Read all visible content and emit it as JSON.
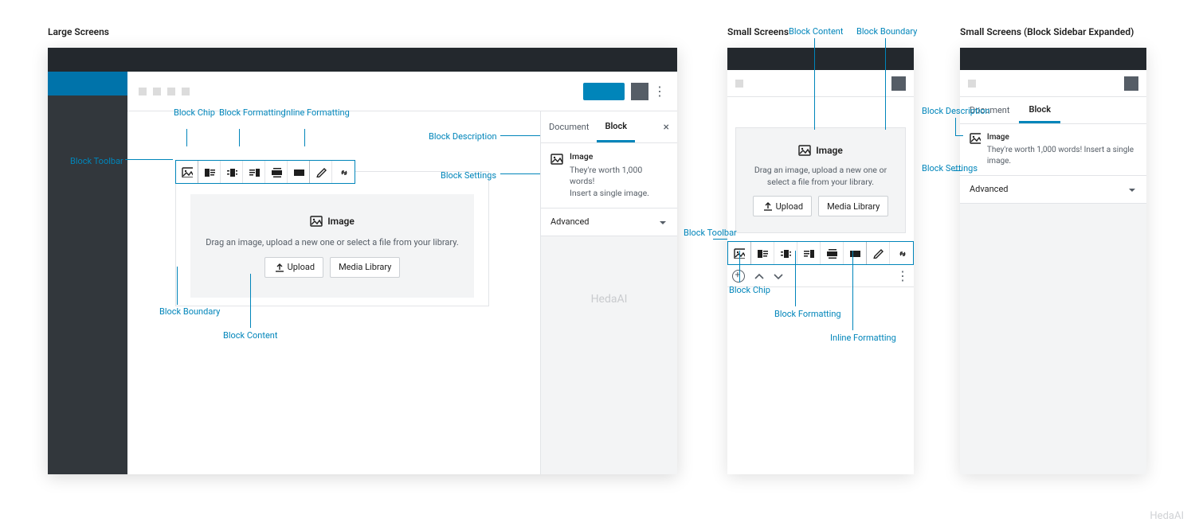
{
  "headings": {
    "large": "Large Screens",
    "small": "Small Screens",
    "small_expanded": "Small Screens (Block Sidebar Expanded)"
  },
  "annotations": {
    "block_toolbar": "Block Toolbar",
    "block_chip": "Block Chip",
    "block_formatting": "Block Formatting",
    "inline_formatting": "Inline Formatting",
    "block_description": "Block Description",
    "block_settings": "Block Settings",
    "block_boundary": "Block Boundary",
    "block_content": "Block Content"
  },
  "sidebar": {
    "tabs": {
      "document": "Document",
      "block": "Block"
    },
    "desc_title": "Image",
    "desc_body_l1": "They're worth 1,000 words!",
    "desc_body_l2": "Insert a single image.",
    "desc_body_one": "They're worth 1,000 words! Insert a single image.",
    "advanced": "Advanced",
    "watermark": "HedaAI"
  },
  "block": {
    "title": "Image",
    "hint": "Drag an image, upload a new one or select a file from your library.",
    "upload": "Upload",
    "media_library": "Media Library"
  },
  "footer_watermark": "HedaAI"
}
